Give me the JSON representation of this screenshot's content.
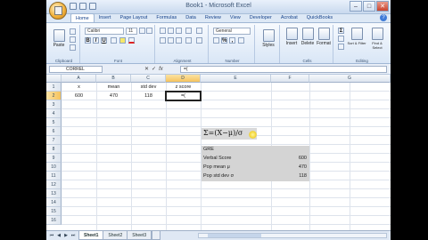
{
  "app": {
    "title": "Book1 - Microsoft Excel",
    "window_controls": [
      "–",
      "□",
      "✕"
    ]
  },
  "ribbon": {
    "tabs": [
      "Home",
      "Insert",
      "Page Layout",
      "Formulas",
      "Data",
      "Review",
      "View",
      "Developer",
      "Acrobat",
      "QuickBooks"
    ],
    "active_tab": "Home",
    "clipboard": {
      "paste_label": "Paste",
      "group_label": "Clipboard"
    },
    "font": {
      "font_name": "Calibri",
      "font_size": "11",
      "group_label": "Font",
      "bold": "B",
      "italic": "I",
      "underline": "U"
    },
    "alignment": {
      "group_label": "Alignment"
    },
    "number": {
      "format": "General",
      "group_label": "Number",
      "percent": "%",
      "comma": ","
    },
    "styles": {
      "label": "Styles"
    },
    "cells": {
      "group_label": "Cells",
      "insert": "Insert",
      "delete": "Delete",
      "format": "Format"
    },
    "editing": {
      "group_label": "Editing",
      "sum": "Σ",
      "sort_filter": "Sort & Filter",
      "find_select": "Find & Select"
    }
  },
  "formula_bar": {
    "name_box": "CORREL",
    "icons": [
      "✕",
      "✓",
      "fx"
    ],
    "formula": "=("
  },
  "grid": {
    "columns": [
      "A",
      "B",
      "C",
      "D",
      "E",
      "F",
      "G"
    ],
    "selected_column": "D",
    "rows": [
      "1",
      "2",
      "3",
      "4",
      "5",
      "6",
      "7",
      "8",
      "9",
      "10",
      "11",
      "12",
      "13",
      "14",
      "15",
      "16"
    ],
    "selected_row": "2",
    "headers": {
      "a": "x",
      "b": "mean",
      "c": "std dev",
      "d": "z score"
    },
    "row2": {
      "a": "600",
      "b": "470",
      "c": "118",
      "d": "=("
    },
    "z_formula": "Σ=(X−μ)/σ",
    "table": {
      "title": "GRE",
      "verbal_label": "Verbal Score",
      "verbal_value": "600",
      "mean_label": "Pop mean μ",
      "mean_value": "470",
      "std_label": "Pop std dev σ",
      "std_value": "118"
    }
  },
  "sheets": {
    "tabs": [
      "Sheet1",
      "Sheet2",
      "Sheet3"
    ],
    "active": "Sheet1"
  }
}
